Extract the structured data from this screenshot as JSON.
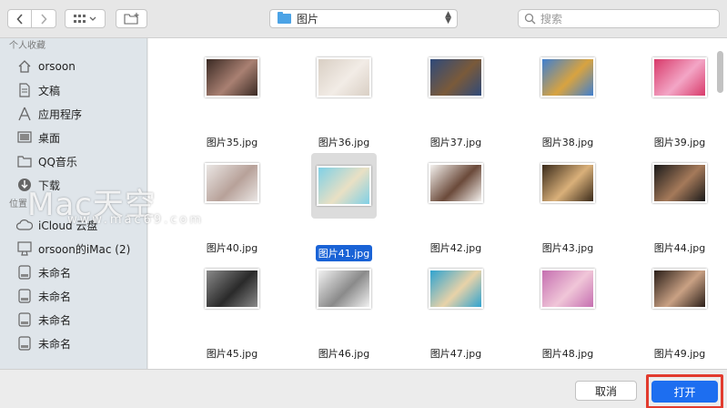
{
  "toolbar": {
    "back_icon": "chevron-left",
    "forward_icon": "chevron-right",
    "view_icon": "grid-view",
    "newfolder_icon": "new-folder",
    "location": "图片",
    "search_placeholder": "搜索"
  },
  "sidebar": {
    "favorites_heading": "个人收藏",
    "favorites": [
      {
        "label": "orsoon",
        "icon": "home-icon"
      },
      {
        "label": "文稿",
        "icon": "document-icon"
      },
      {
        "label": "应用程序",
        "icon": "apps-icon"
      },
      {
        "label": "桌面",
        "icon": "desktop-icon"
      },
      {
        "label": "QQ音乐",
        "icon": "folder-icon"
      },
      {
        "label": "下载",
        "icon": "download-icon"
      }
    ],
    "locations_heading": "位置",
    "locations": [
      {
        "label": "iCloud 云盘",
        "icon": "cloud-icon"
      },
      {
        "label": "orsoon的iMac (2)",
        "icon": "imac-icon"
      },
      {
        "label": "未命名",
        "icon": "disk-icon"
      },
      {
        "label": "未命名",
        "icon": "disk-icon"
      },
      {
        "label": "未命名",
        "icon": "disk-icon"
      },
      {
        "label": "未命名",
        "icon": "disk-icon"
      }
    ]
  },
  "files": [
    {
      "name": "图片35.jpg",
      "colors": [
        "#3a2a24",
        "#a98072"
      ]
    },
    {
      "name": "图片36.jpg",
      "colors": [
        "#d9cfc4",
        "#f2ece6"
      ]
    },
    {
      "name": "图片37.jpg",
      "colors": [
        "#2f4a7a",
        "#7a5a3a"
      ]
    },
    {
      "name": "图片38.jpg",
      "colors": [
        "#3f7fd0",
        "#d8a340"
      ]
    },
    {
      "name": "图片39.jpg",
      "colors": [
        "#d83a6a",
        "#f3a6c6"
      ]
    },
    {
      "name": "图片40.jpg",
      "colors": [
        "#eae6e4",
        "#b7a199"
      ]
    },
    {
      "name": "图片41.jpg",
      "colors": [
        "#7fd0e6",
        "#e9e0c4"
      ],
      "selected": true
    },
    {
      "name": "图片42.jpg",
      "colors": [
        "#f4f1ee",
        "#6b4a3a"
      ]
    },
    {
      "name": "图片43.jpg",
      "colors": [
        "#3a2a1a",
        "#d9b07a"
      ]
    },
    {
      "name": "图片44.jpg",
      "colors": [
        "#1a1a1a",
        "#a57a5a"
      ]
    },
    {
      "name": "图片45.jpg",
      "colors": [
        "#8a8a8a",
        "#2a2a2a"
      ]
    },
    {
      "name": "图片46.jpg",
      "colors": [
        "#f1f1f1",
        "#8a8a8a"
      ]
    },
    {
      "name": "图片47.jpg",
      "colors": [
        "#2fa3d0",
        "#e8d2a8"
      ]
    },
    {
      "name": "图片48.jpg",
      "colors": [
        "#c56fb0",
        "#f0c6d8"
      ]
    },
    {
      "name": "图片49.jpg",
      "colors": [
        "#2a1e18",
        "#c9a184"
      ]
    }
  ],
  "watermark": {
    "text": "Mac天空",
    "url": "www.mac69.com"
  },
  "footer": {
    "cancel": "取消",
    "open": "打开"
  }
}
